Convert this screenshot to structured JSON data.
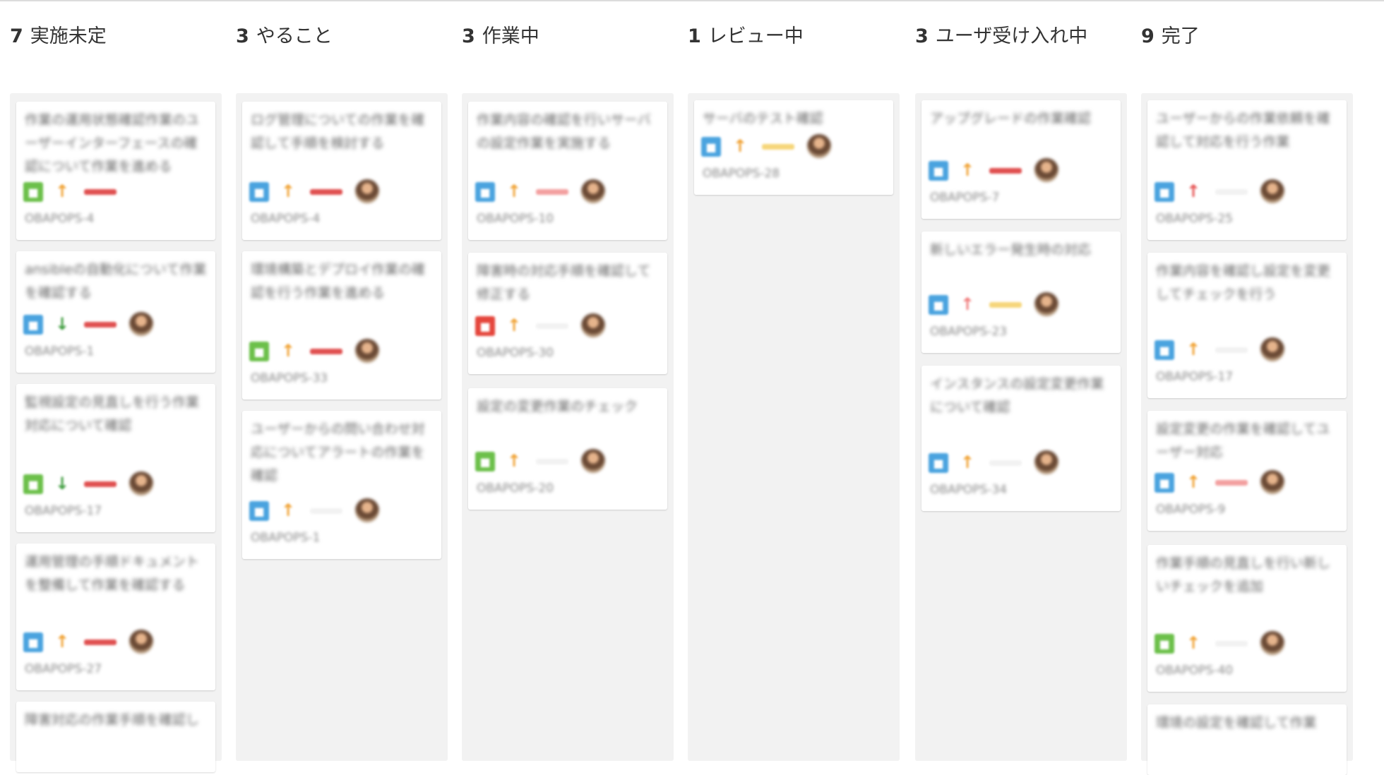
{
  "columns": [
    {
      "count": "7",
      "title": "実施未定",
      "cards": [
        {
          "summary": "作業の運用状態確認作業のユーザーインターフェースの確認について作業を進める",
          "type": "green",
          "type_glyph": "■",
          "priority": "orange",
          "label": "red",
          "avatar": false,
          "key": "OBAPOPS-4"
        },
        {
          "summary": "ansibleの自動化について作業を確認する",
          "type": "blue",
          "type_glyph": "■",
          "priority": "green",
          "label": "red",
          "avatar": true,
          "key": "OBAPOPS-1"
        },
        {
          "summary": "監視設定の見直しを行う作業対応について確認",
          "type": "green",
          "type_glyph": "■",
          "priority": "green",
          "label": "red",
          "avatar": true,
          "key": "OBAPOPS-17"
        },
        {
          "summary": "運用管理の手順ドキュメントを整備して作業を確認する",
          "type": "blue",
          "type_glyph": "■",
          "priority": "orange",
          "label": "red",
          "avatar": true,
          "key": "OBAPOPS-27"
        },
        {
          "summary": "障害対応の作業手順を確認しユーザー対応",
          "type": "blue",
          "type_glyph": "■",
          "priority": "orange",
          "label": "red",
          "avatar": false,
          "key": ""
        }
      ]
    },
    {
      "count": "3",
      "title": "やること",
      "cards": [
        {
          "summary": "ログ管理についての作業を確認して手順を検討する",
          "type": "blue",
          "type_glyph": "■",
          "priority": "orange",
          "label": "red",
          "avatar": true,
          "key": "OBAPOPS-4"
        },
        {
          "summary": "環境構築とデプロイ作業の確認を行う作業を進める",
          "type": "green",
          "type_glyph": "■",
          "priority": "orange",
          "label": "red",
          "avatar": true,
          "key": "OBAPOPS-33"
        },
        {
          "summary": "ユーザーからの問い合わせ対応についてアラートの作業を確認",
          "type": "blue",
          "type_glyph": "■",
          "priority": "orange",
          "label": "none",
          "avatar": true,
          "key": "OBAPOPS-1"
        }
      ]
    },
    {
      "count": "3",
      "title": "作業中",
      "cards": [
        {
          "summary": "作業内容の確認を行いサーバの設定作業を実施する",
          "type": "blue",
          "type_glyph": "■",
          "priority": "orange",
          "label": "pink",
          "avatar": true,
          "key": "OBAPOPS-10"
        },
        {
          "summary": "障害時の対応手順を確認して修正する",
          "type": "red",
          "type_glyph": "■",
          "priority": "orange",
          "label": "none",
          "avatar": true,
          "key": "OBAPOPS-30"
        },
        {
          "summary": "設定の変更作業のチェック",
          "type": "green",
          "type_glyph": "■",
          "priority": "orange",
          "label": "none",
          "avatar": true,
          "key": "OBAPOPS-20"
        }
      ]
    },
    {
      "count": "1",
      "title": "レビュー中",
      "cards": [
        {
          "summary": "サーバのテスト確認",
          "type": "blue",
          "type_glyph": "■",
          "priority": "orange",
          "label": "yellow",
          "avatar": true,
          "key": "OBAPOPS-28"
        }
      ]
    },
    {
      "count": "3",
      "title": "ユーザ受け入れ中",
      "cards": [
        {
          "summary": "アップグレードの作業確認",
          "type": "blue",
          "type_glyph": "■",
          "priority": "orange",
          "label": "red",
          "avatar": true,
          "key": "OBAPOPS-7"
        },
        {
          "summary": "新しいエラー発生時の対応",
          "type": "blue",
          "type_glyph": "■",
          "priority": "pink",
          "label": "yellow",
          "avatar": true,
          "key": "OBAPOPS-23"
        },
        {
          "summary": "インスタンスの設定変更作業について確認",
          "type": "blue",
          "type_glyph": "■",
          "priority": "orange",
          "label": "none",
          "avatar": true,
          "key": "OBAPOPS-34"
        }
      ]
    },
    {
      "count": "9",
      "title": "完了",
      "cards": [
        {
          "summary": "ユーザーからの作業依頼を確認して対応を行う作業",
          "type": "blue",
          "type_glyph": "■",
          "priority": "red",
          "label": "none",
          "avatar": true,
          "key": "OBAPOPS-25"
        },
        {
          "summary": "作業内容を確認し設定を変更してチェックを行う",
          "type": "blue",
          "type_glyph": "■",
          "priority": "orange",
          "label": "none",
          "avatar": true,
          "key": "OBAPOPS-17"
        },
        {
          "summary": "設定変更の作業を確認してユーザー対応",
          "type": "blue",
          "type_glyph": "■",
          "priority": "orange",
          "label": "pink",
          "avatar": true,
          "key": "OBAPOPS-9"
        },
        {
          "summary": "作業手順の見直しを行い新しいチェックを追加",
          "type": "green",
          "type_glyph": "■",
          "priority": "orange",
          "label": "none",
          "avatar": true,
          "key": "OBAPOPS-40"
        },
        {
          "summary": "環境の設定を確認して作業",
          "type": "blue",
          "type_glyph": "■",
          "priority": "orange",
          "label": "none",
          "avatar": false,
          "key": ""
        }
      ]
    }
  ],
  "colors": {
    "type": {
      "green": "#6cc04a",
      "blue": "#4aa3df",
      "red": "#e5463c"
    },
    "priority": {
      "orange": "#f0a030",
      "green": "#3a9a3a",
      "red": "#e55050",
      "pink": "#f07a7a"
    },
    "label": {
      "red": "#e05050",
      "pink": "#f3a0a0",
      "yellow": "#f6d67a",
      "none": "#f2f2f2"
    }
  }
}
